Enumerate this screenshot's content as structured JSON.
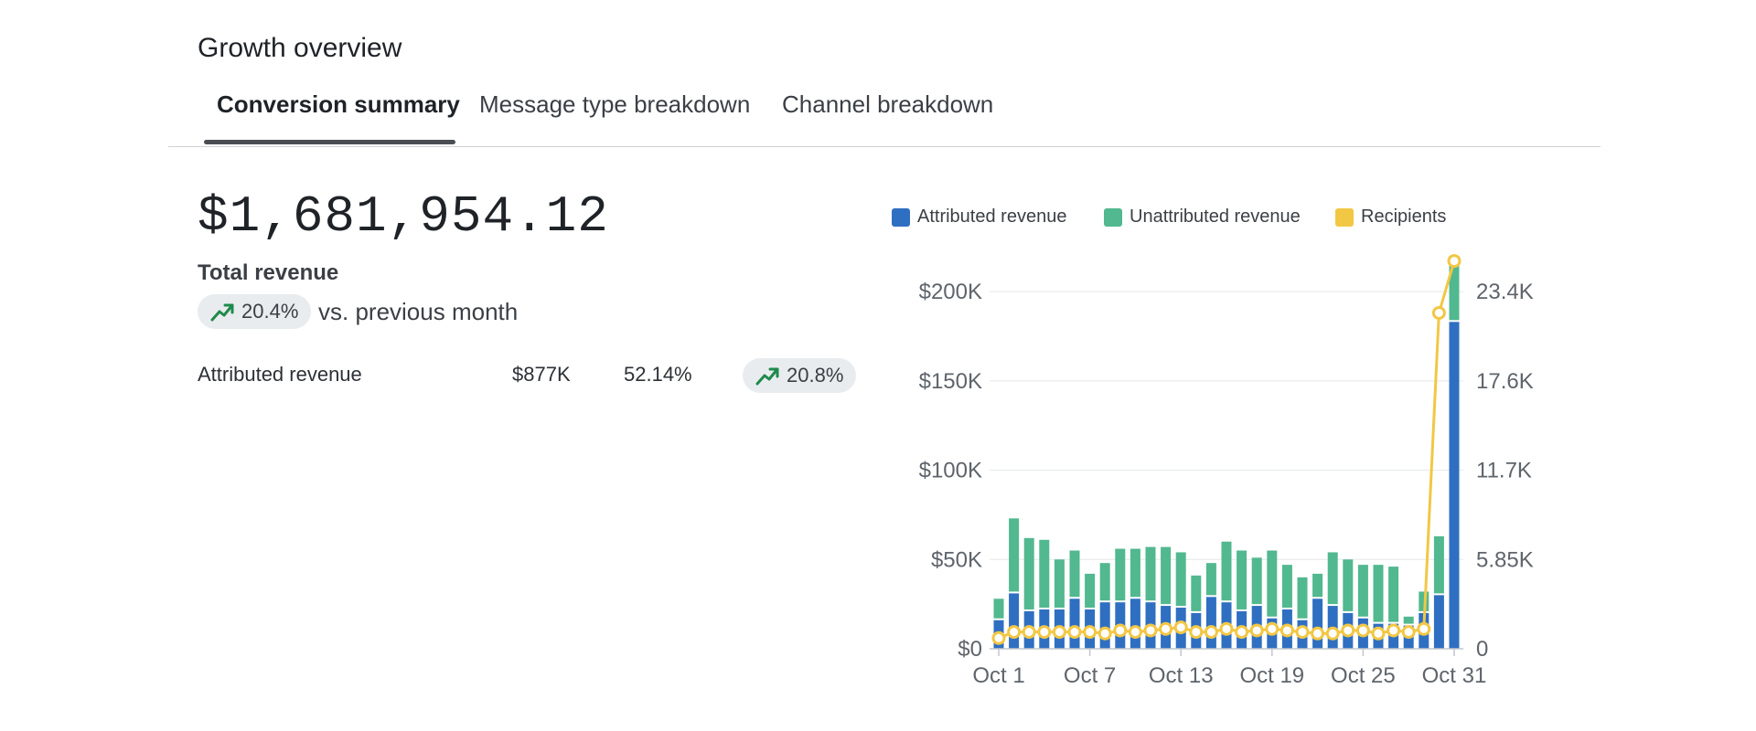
{
  "header": {
    "title": "Growth overview"
  },
  "tabs": [
    {
      "label": "Conversion summary",
      "active": true
    },
    {
      "label": "Message type breakdown",
      "active": false
    },
    {
      "label": "Channel breakdown",
      "active": false
    }
  ],
  "summary": {
    "total_value": "$1,681,954.12",
    "total_label": "Total revenue",
    "change_pct": "20.4%",
    "change_direction": "up",
    "change_caption": "vs. previous month",
    "trend_icon": "trending-up-icon"
  },
  "breakdown_rows": [
    {
      "label": "Attributed revenue",
      "value": "$877K",
      "share": "52.14%",
      "change_pct": "20.8%",
      "change_direction": "up"
    }
  ],
  "colors": {
    "attributed": "#2f6fc1",
    "unattributed": "#52b88f",
    "recipients": "#f2c744",
    "trend_up": "#1e8a4c",
    "pill_bg": "#e9ecef",
    "grid": "#e6e8eb",
    "axis_text": "#5f646b"
  },
  "chart_data": {
    "type": "bar",
    "stacked": true,
    "legend": [
      "Attributed revenue",
      "Unattributed revenue",
      "Recipients"
    ],
    "legend_position": "top",
    "grid": true,
    "x": [
      "Oct 1",
      "Oct 2",
      "Oct 3",
      "Oct 4",
      "Oct 5",
      "Oct 6",
      "Oct 7",
      "Oct 8",
      "Oct 9",
      "Oct 10",
      "Oct 11",
      "Oct 12",
      "Oct 13",
      "Oct 14",
      "Oct 15",
      "Oct 16",
      "Oct 17",
      "Oct 18",
      "Oct 19",
      "Oct 20",
      "Oct 21",
      "Oct 22",
      "Oct 23",
      "Oct 24",
      "Oct 25",
      "Oct 26",
      "Oct 27",
      "Oct 28",
      "Oct 29",
      "Oct 30",
      "Oct 31"
    ],
    "x_tick_labels": [
      "Oct 1",
      "Oct 7",
      "Oct 13",
      "Oct 19",
      "Oct 25",
      "Oct 31"
    ],
    "series": [
      {
        "name": "Attributed revenue",
        "axis": "left",
        "kind": "bar",
        "values": [
          16000,
          31000,
          21000,
          22000,
          22000,
          28000,
          22000,
          26000,
          26000,
          28000,
          26000,
          24000,
          23000,
          20000,
          29000,
          26000,
          21000,
          24000,
          17000,
          22000,
          16000,
          28000,
          24000,
          20000,
          17000,
          14000,
          14000,
          13000,
          20000,
          30000,
          183000
        ]
      },
      {
        "name": "Unattributed revenue",
        "axis": "left",
        "kind": "bar",
        "values": [
          12000,
          42000,
          41000,
          39000,
          28000,
          27000,
          20000,
          22000,
          30000,
          28000,
          31000,
          33000,
          31000,
          21000,
          19000,
          34000,
          34000,
          27000,
          38000,
          25000,
          24000,
          14000,
          30000,
          30000,
          30000,
          33000,
          32000,
          5000,
          12000,
          33000,
          37000
        ]
      },
      {
        "name": "Recipients",
        "axis": "right",
        "kind": "line",
        "values": [
          700,
          1100,
          1100,
          1100,
          1100,
          1100,
          1100,
          1000,
          1200,
          1100,
          1200,
          1300,
          1400,
          1100,
          1100,
          1300,
          1100,
          1200,
          1300,
          1200,
          1100,
          1000,
          1000,
          1200,
          1200,
          1000,
          1200,
          1100,
          1300,
          22000,
          25400
        ]
      }
    ],
    "y_left": {
      "label": "",
      "range": [
        0,
        220000
      ],
      "ticks": [
        0,
        50000,
        100000,
        150000,
        200000
      ],
      "tick_labels": [
        "$0",
        "$50K",
        "$100K",
        "$150K",
        "$200K"
      ]
    },
    "y_right": {
      "label": "",
      "range": [
        0,
        25740
      ],
      "ticks": [
        0,
        5850,
        11700,
        17550,
        23400
      ],
      "tick_labels": [
        "0",
        "5.85K",
        "11.7K",
        "17.6K",
        "23.4K"
      ]
    }
  }
}
